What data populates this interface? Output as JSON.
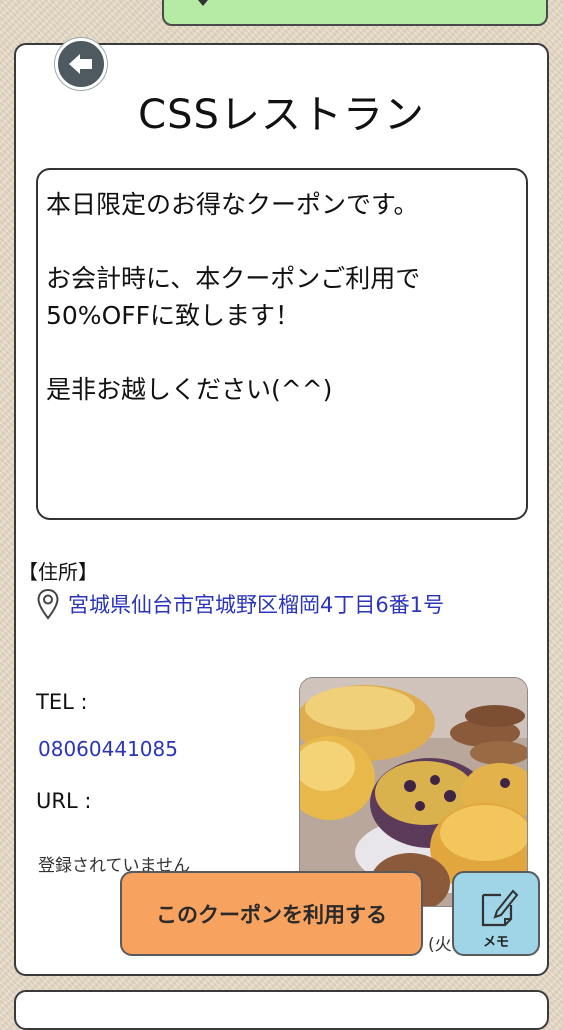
{
  "title": "CSSレストラン",
  "message_lines": [
    "本日限定のお得なクーポンです。",
    "",
    "お会計時に、本クーポンご利用で",
    "50%OFFに致します！",
    "",
    "是非お越しください(^^)"
  ],
  "address": {
    "label": "【住所】",
    "text": "宮城県仙台市宮城野区榴岡4丁目6番1号"
  },
  "contact": {
    "tel_label": "TEL :",
    "tel_value": "08060441085",
    "url_label": "URL :",
    "url_value": "登録されていません"
  },
  "hours_fragment": "(火",
  "buttons": {
    "use_coupon": "このクーポンを利用する",
    "memo": "メモ"
  },
  "icons": {
    "back": "back-arrow-icon",
    "pin": "map-pin-icon",
    "memo": "edit-note-icon"
  },
  "colors": {
    "top_tab": "#b6eba6",
    "link": "#2b35b8",
    "use_coupon_button": "#f7a25f",
    "memo_button": "#9fd5e6",
    "back_button": "#4e5a60"
  }
}
